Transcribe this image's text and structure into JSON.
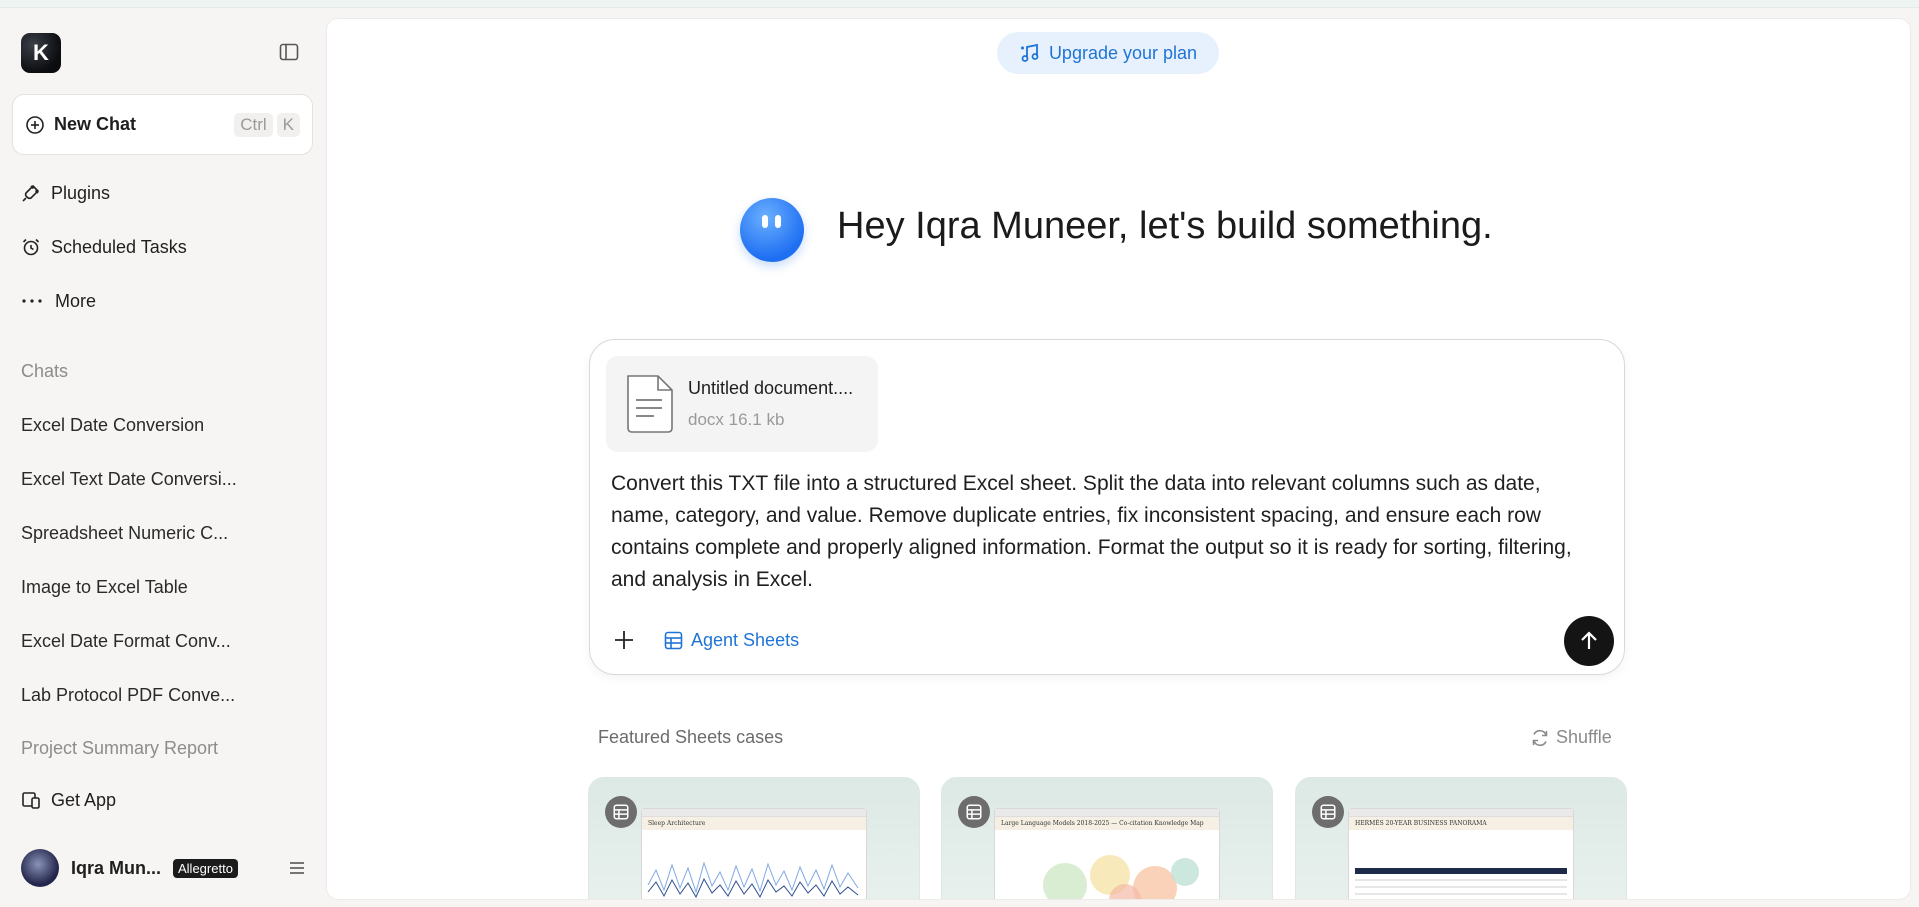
{
  "sidebar": {
    "logo_letter": "K",
    "new_chat": {
      "label": "New Chat",
      "shortcut_ctrl": "Ctrl",
      "shortcut_key": "K"
    },
    "nav": [
      {
        "label": "Plugins",
        "icon": "plug-icon"
      },
      {
        "label": "Scheduled Tasks",
        "icon": "alarm-clock-icon"
      },
      {
        "label": "More",
        "icon": "more-dots-icon"
      }
    ],
    "chats_title": "Chats",
    "chats": [
      "Excel Date Conversion",
      "Excel Text Date Conversi...",
      "Spreadsheet Numeric C...",
      "Image to Excel Table",
      "Excel Date Format Conv...",
      "Lab Protocol PDF Conve..."
    ],
    "project": "Project Summary Report",
    "get_app": "Get App",
    "user": {
      "name": "Iqra Mun...",
      "plan": "Allegretto"
    }
  },
  "main": {
    "upgrade_label": "Upgrade your plan",
    "greeting": "Hey Iqra Muneer, let's build something.",
    "composer": {
      "attachment": {
        "name": "Untitled document....",
        "meta": "docx 16.1 kb"
      },
      "prompt": "Convert this TXT file into a structured Excel sheet. Split the data into relevant columns such as date, name, category, and value. Remove duplicate entries, fix inconsistent spacing, and ensure each row contains complete and properly aligned information. Format the output so it is ready for sorting, filtering, and analysis in Excel.",
      "agent_label": "Agent Sheets"
    },
    "featured_title": "Featured Sheets cases",
    "shuffle_label": "Shuffle",
    "cards": [
      {
        "title": "Sleep Architecture"
      },
      {
        "title": "Large Language Models 2018-2025 — Co-citation Knowledge Map"
      },
      {
        "title": "HERMÈS 20-YEAR BUSINESS PANORAMA"
      }
    ]
  },
  "colors": {
    "accent": "#1f74d6",
    "upgrade_bg": "#e7f1fd",
    "send_bg": "#141414"
  }
}
